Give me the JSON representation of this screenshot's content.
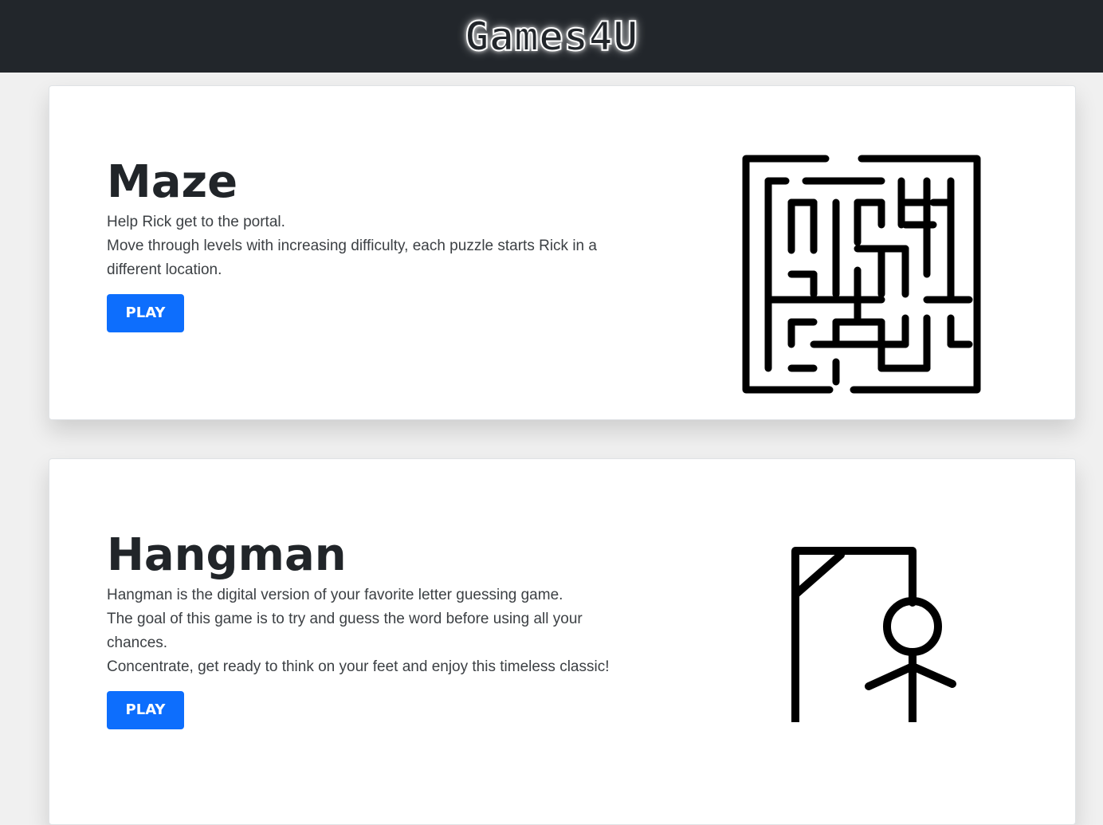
{
  "navbar": {
    "brand": "Games4U"
  },
  "games": [
    {
      "title": "Maze",
      "lines": [
        "Help Rick get to the portal.",
        "Move through levels with increasing difficulty, each puzzle starts Rick in a different location."
      ],
      "button_label": "PLAY",
      "image_icon": "maze-icon"
    },
    {
      "title": "Hangman",
      "lines": [
        "Hangman is the digital version of your favorite letter guessing game.",
        "The goal of this game is to try and guess the word before using all your chances.",
        "Concentrate, get ready to think on your feet and enjoy this timeless classic!"
      ],
      "button_label": "PLAY",
      "image_icon": "hangman-icon"
    }
  ],
  "colors": {
    "navbar_bg": "#22262b",
    "button_bg": "#0d6efd",
    "page_bg": "#f0f0f0"
  }
}
